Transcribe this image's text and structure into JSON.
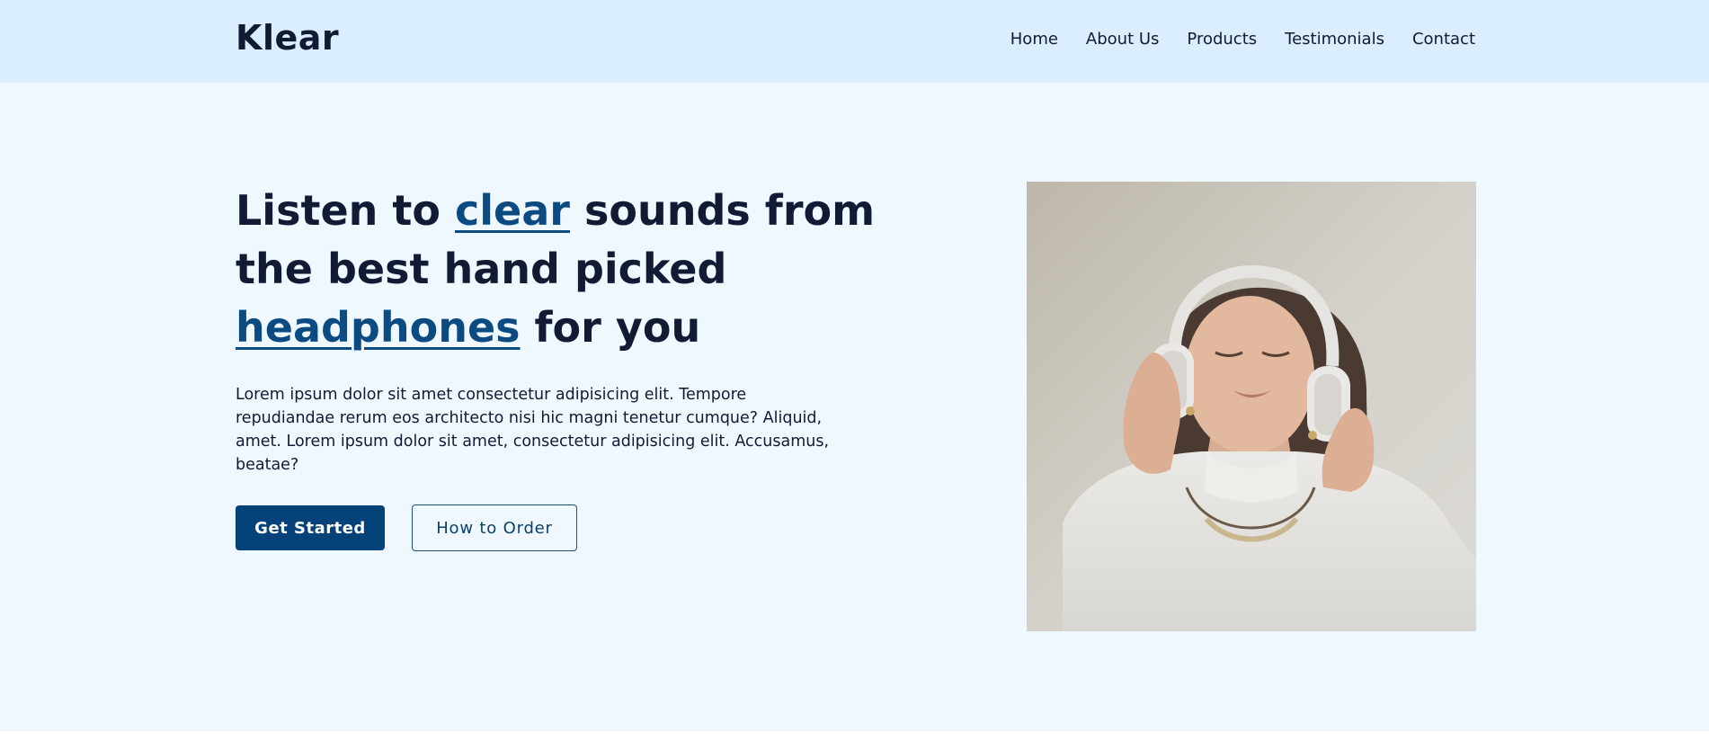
{
  "brand": {
    "name": "Klear"
  },
  "nav": {
    "items": [
      {
        "label": "Home"
      },
      {
        "label": "About Us"
      },
      {
        "label": "Products"
      },
      {
        "label": "Testimonials"
      },
      {
        "label": "Contact"
      }
    ]
  },
  "hero": {
    "title_part1": "Listen to ",
    "title_hl1": "clear",
    "title_part2": " sounds from the best hand picked ",
    "title_hl2": "headphones",
    "title_part3": " for you",
    "description": "Lorem ipsum dolor sit amet consectetur adipisicing elit. Tempore repudiandae rerum eos architecto nisi hic magni tenetur cumque? Aliquid, amet. Lorem ipsum dolor sit amet, consectetur adipisicing elit. Accusamus, beatae?",
    "primary_button": "Get Started",
    "secondary_button": "How to Order",
    "image_subject": "woman-with-headphones-photo"
  },
  "colors": {
    "navbar_bg": "#dbeefe",
    "hero_bg": "#f0f8ff",
    "text_dark": "#111b34",
    "accent": "#044279",
    "highlight": "#0c4a82"
  }
}
